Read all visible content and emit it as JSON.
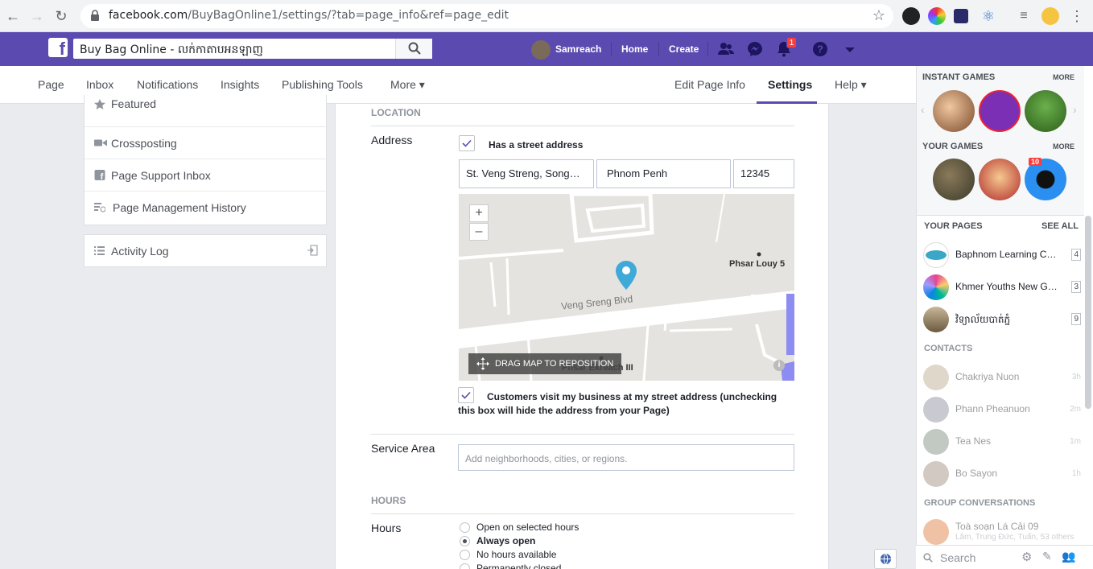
{
  "browser": {
    "url_main": "facebook.com",
    "url_path": "/BuyBagOnline1/settings/?tab=page_info&ref=page_edit"
  },
  "fb": {
    "search_value": "Buy Bag Online - លក់កាតាបអនឡាញ",
    "user": "Samreach",
    "home": "Home",
    "create": "Create",
    "notification_count": "1",
    "accent": "#5b4bb0"
  },
  "tabs": {
    "left": [
      "Page",
      "Inbox",
      "Notifications",
      "Insights",
      "Publishing Tools",
      "More ▾"
    ],
    "right": [
      "Edit Page Info",
      "Settings",
      "Help ▾"
    ]
  },
  "leftnav": {
    "items": [
      "Featured",
      "Crossposting",
      "Page Support Inbox",
      "Page Management History"
    ],
    "activity": "Activity Log"
  },
  "location": {
    "heading": "LOCATION",
    "address_label": "Address",
    "has_street": "Has a street address",
    "street": "St. Veng Streng, Song…",
    "city": "Phnom Penh",
    "zip": "12345",
    "map_label_1": "Phsar Louy 5",
    "map_road": "Veng Sreng Blvd",
    "map_label_2": "Phsar Ekreach III",
    "zoom_in": "+",
    "zoom_out": "–",
    "drag_text": "DRAG MAP TO REPOSITION",
    "customers_visit": "Customers visit my business at my street address (unchecking this box will hide the address from your Page)",
    "service_area_label": "Service Area",
    "service_area_placeholder": "Add neighborhoods, cities, or regions."
  },
  "hours": {
    "heading": "HOURS",
    "label": "Hours",
    "options": [
      "Open on selected hours",
      "Always open",
      "No hours available",
      "Permanently closed"
    ],
    "selected": "Always open"
  },
  "sidebar": {
    "instant_games": "INSTANT GAMES",
    "your_games": "YOUR GAMES",
    "more": "MORE",
    "game_badge": "10",
    "your_pages": "YOUR PAGES",
    "see_all": "SEE ALL",
    "pages": [
      {
        "name": "Baphnom Learning Cl…",
        "count": "4"
      },
      {
        "name": "Khmer Youths New G…",
        "count": "3"
      },
      {
        "name": "វិទ្យាល័យបាត់ភ្នំ",
        "count": "9"
      }
    ],
    "contacts_heading": "CONTACTS",
    "contacts": [
      {
        "name": "Chakriya Nuon",
        "time": "3h"
      },
      {
        "name": "Phann Pheanuon",
        "time": "2m"
      },
      {
        "name": "Tea Nes",
        "time": "1m"
      },
      {
        "name": "Bo Sayon",
        "time": "1h"
      }
    ],
    "group_heading": "GROUP CONVERSATIONS",
    "group_name": "Toà soạn Lá Cải 09",
    "group_members": "Lâm, Trung Đức, Tuấn, 53 others",
    "search_placeholder": "Search"
  }
}
